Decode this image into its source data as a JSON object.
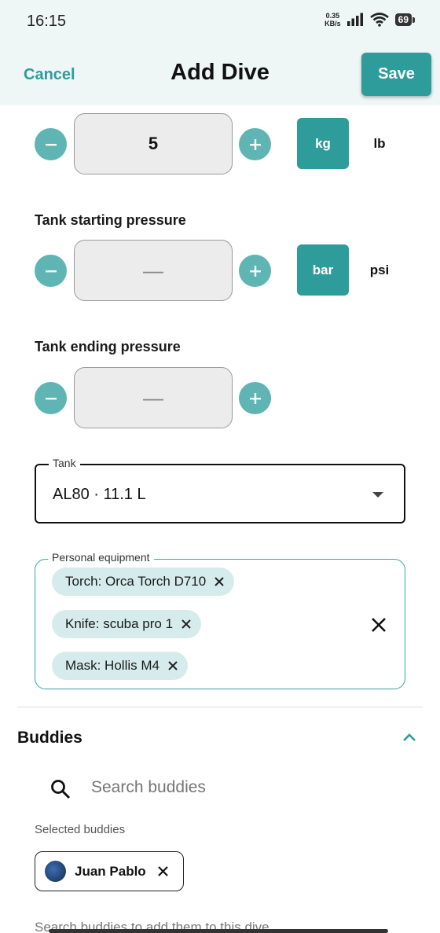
{
  "status": {
    "time": "16:15",
    "net_speed_value": "0.35",
    "net_speed_unit": "KB/s",
    "battery": "69"
  },
  "header": {
    "cancel_label": "Cancel",
    "title": "Add Dive",
    "save_label": "Save"
  },
  "weight": {
    "value": "5",
    "unit_active": "kg",
    "unit_inactive": "lb"
  },
  "tank_start": {
    "label": "Tank starting pressure",
    "value": "—",
    "unit_active": "bar",
    "unit_inactive": "psi"
  },
  "tank_end": {
    "label": "Tank ending pressure",
    "value": "—"
  },
  "tank": {
    "label": "Tank",
    "value": "AL80 · 11.1 L"
  },
  "equipment": {
    "label": "Personal equipment",
    "items": [
      "Torch: Orca Torch D710",
      "Knife: scuba pro 1",
      "Mask: Hollis M4"
    ]
  },
  "buddies": {
    "title": "Buddies",
    "search_placeholder": "Search buddies",
    "selected_label": "Selected buddies",
    "selected": [
      {
        "name": "Juan Pablo"
      }
    ],
    "hint": "Search buddies to add them to this dive"
  },
  "colors": {
    "accent": "#2f9c9c",
    "accent_light": "#5fb4b4",
    "chip_bg": "#d6ecec",
    "header_bg": "#eef6f6"
  }
}
